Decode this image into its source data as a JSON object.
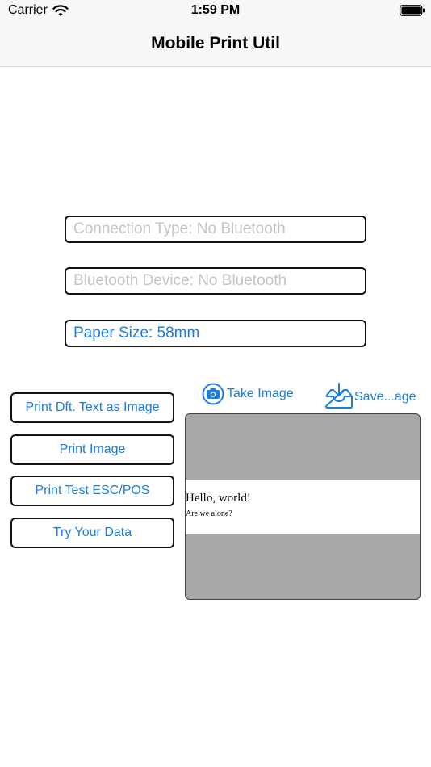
{
  "status_bar": {
    "carrier": "Carrier",
    "time": "1:59 PM"
  },
  "nav": {
    "title": "Mobile Print Util"
  },
  "fields": {
    "connection_type": "Connection Type: No Bluetooth",
    "bluetooth_device": "Bluetooth Device: No Bluetooth",
    "paper_size": "Paper Size: 58mm"
  },
  "buttons": {
    "print_default_text": "Print Dft. Text as Image",
    "print_image": "Print Image",
    "print_test": "Print Test ESC/POS",
    "try_data": "Try Your Data"
  },
  "image_actions": {
    "take_image": "Take Image",
    "save_image": "Save...age"
  },
  "preview": {
    "line1": "Hello, world!",
    "line2": "Are we alone?"
  },
  "colors": {
    "accent": "#1a7de0",
    "placeholder": "#c5c5c8",
    "preview_bg": "#a8a8a8"
  },
  "icons": {
    "wifi": "wifi-icon",
    "battery": "battery-icon",
    "camera": "camera-icon",
    "save": "tray-download-icon"
  }
}
